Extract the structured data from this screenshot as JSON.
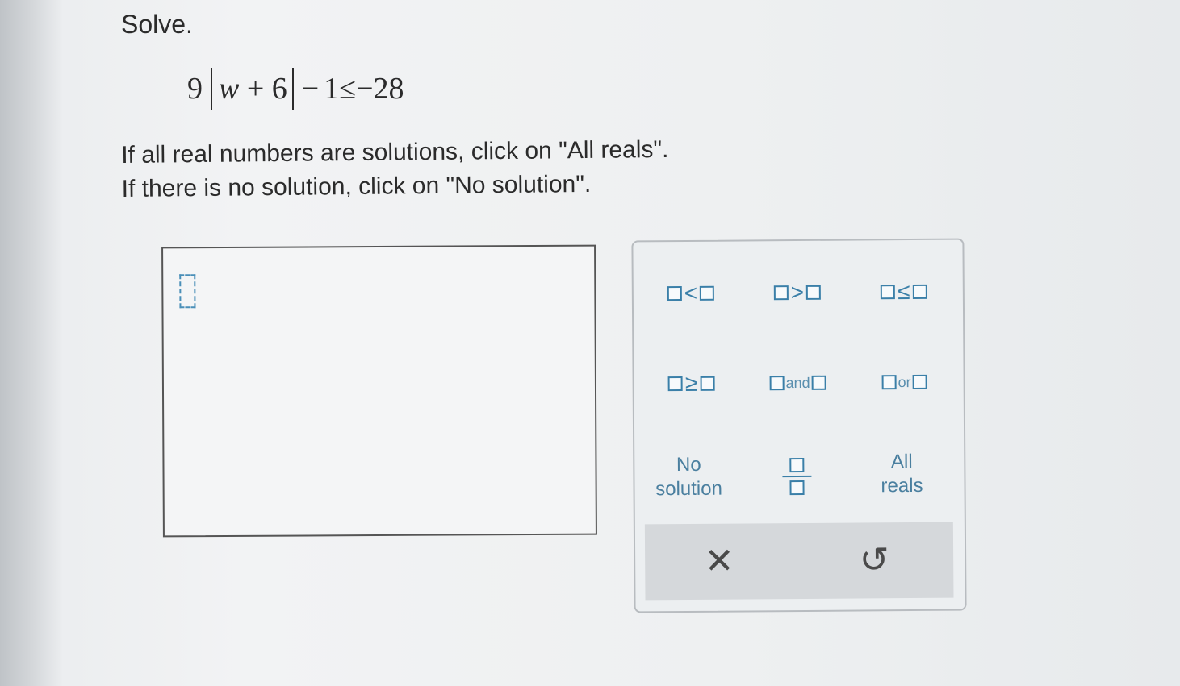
{
  "question": {
    "prompt": "Solve.",
    "equation": {
      "coefficient": "9",
      "abs_var": "w",
      "abs_plus": "+",
      "abs_const": "6",
      "minus": "−",
      "subtrahend": "1",
      "relation": "≤",
      "rhs": "−28"
    },
    "instruction_1": "If all real numbers are solutions, click on \"All reals\".",
    "instruction_2": "If there is no solution, click on \"No solution\"."
  },
  "keypad": {
    "less_than": "<",
    "greater_than": ">",
    "less_equal": "≤",
    "greater_equal": "≥",
    "and_word": "and",
    "or_word": "or",
    "no_solution_line1": "No",
    "no_solution_line2": "solution",
    "all_reals_line1": "All",
    "all_reals_line2": "reals",
    "clear_symbol": "✕",
    "undo_symbol": "↺"
  }
}
